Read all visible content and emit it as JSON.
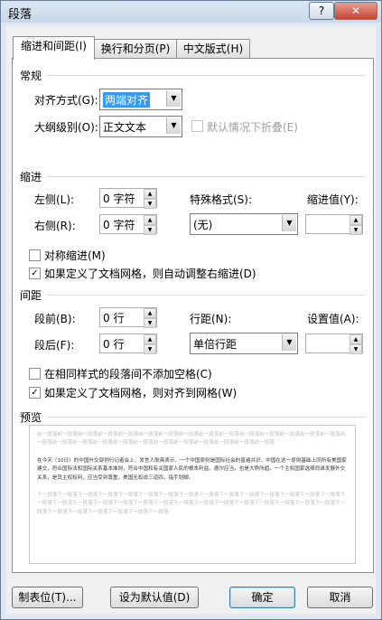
{
  "window": {
    "title": "段落",
    "help": "?",
    "close": "✕"
  },
  "tabs": [
    {
      "label": "缩进和间距(I)"
    },
    {
      "label": "换行和分页(P)"
    },
    {
      "label": "中文版式(H)"
    }
  ],
  "general": {
    "heading": "常规",
    "alignment_label": "对齐方式(G):",
    "alignment_value": "两端对齐",
    "outline_label": "大纲级别(O):",
    "outline_value": "正文文本",
    "collapse_label": "默认情况下折叠(E)"
  },
  "indent": {
    "heading": "缩进",
    "left_label": "左侧(L):",
    "left_value": "0 字符",
    "right_label": "右侧(R):",
    "right_value": "0 字符",
    "special_label": "特殊格式(S):",
    "special_value": "(无)",
    "by_label": "缩进值(Y):",
    "mirror_label": "对称缩进(M)",
    "auto_adjust_label": "如果定义了文档网格，则自动调整右缩进(D)"
  },
  "spacing": {
    "heading": "间距",
    "before_label": "段前(B):",
    "before_value": "0 行",
    "after_label": "段后(F):",
    "after_value": "0 行",
    "line_label": "行距(N):",
    "line_value": "单倍行距",
    "at_label": "设置值(A):",
    "no_space_label": "在相同样式的段落间不添加空格(C)",
    "snap_grid_label": "如果定义了文档网格，则对齐到网格(W)"
  },
  "preview": {
    "heading": "预览",
    "prev_para": "前一段落前一段落前一段落前一段落前一段落前一段落前一段落前一段落前一段落前一段落前一段落前一段落前一段落前一段落前一段落前一段落前一段落前一段落前一段落前一段落前一段落前一段落前一段落前一段落前一段落前一段落前一段落",
    "sample": "在今天（10日）的中国外交部例行记者会上，发言人耿爽表示，一个中国原则是国际社会的普遍共识，中国在这一原则基础上同所有美国家建交，符合国际法和国际关系基本准则，符合中国和有关国家人民的根本利益。德尔应当，也是大势所趋，一个主权国家选择同谁发展外交关系，是其主权权利，应当受到尊重，美国无权说三道四，指手划脚。",
    "next_para": "下一段落下一段落下一段落下一段落下一段落下一段落下一段落下一段落下一段落下一段落下一段落下一段落下一段落下一段落下一段落下一段落下一段落下一段落下一段落下一段落下一段落下一段落下一段落下一段落下一段落下一段落下一段落下一段落下一段落下一段落下一段落下一段落下一段落下一段落下一段落下一段落下一段落"
  },
  "buttons": {
    "tabs": "制表位(T)...",
    "set_default": "设为默认值(D)",
    "ok": "确定",
    "cancel": "取消"
  }
}
